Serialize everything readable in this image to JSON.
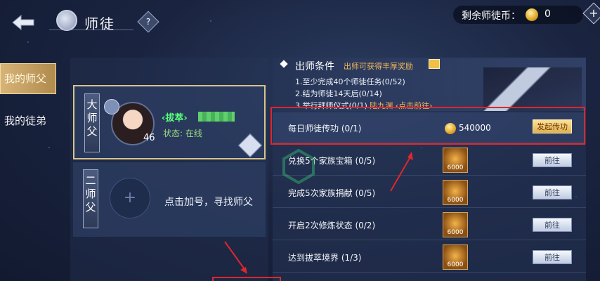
{
  "header": {
    "title": "师徒",
    "help_label": "?",
    "currency_label": "剩余师徒币：",
    "currency_value": "0",
    "add_label": "+"
  },
  "tabs": [
    {
      "label": "我的师父",
      "active": true
    },
    {
      "label": "我的徒弟",
      "active": false
    }
  ],
  "masters": {
    "first": {
      "rank": "大师父",
      "name": "‹拔萃›",
      "level": "46",
      "status": "状态: 在线"
    },
    "second": {
      "rank": "二师父",
      "add_label": "+",
      "empty_text": "点击加号，寻找师父"
    }
  },
  "conditions": {
    "title": "出师条件",
    "subtitle": "出师可获得丰厚奖励",
    "lines": [
      "1.至少完成40个师徒任务(0/52)",
      "2.结为师徒14天后(0/14)",
      "3.举行拜师仪式(0/1)"
    ],
    "link_text": "陆九渊 ‹点击前往›"
  },
  "tasks": [
    {
      "label": "每日师徒传功 (0/1)",
      "reward_text": "540000",
      "button": "发起传功"
    },
    {
      "label": "兑换5个家族宝箱 (0/5)",
      "reward_text": "6000",
      "button": "前往"
    },
    {
      "label": "完成5次家族捐献 (0/5)",
      "reward_text": "6000",
      "button": "前往"
    },
    {
      "label": "开启2次修炼状态 (0/2)",
      "reward_text": "6000",
      "button": "前往"
    },
    {
      "label": "达到拔萃境界 (1/3)",
      "reward_text": "6000",
      "button": "前往"
    }
  ],
  "colors": {
    "accent_gold": "#d8b478",
    "highlight_red": "#e0262c",
    "online_green": "#57ff7a",
    "link_orange": "#f3b85c"
  }
}
